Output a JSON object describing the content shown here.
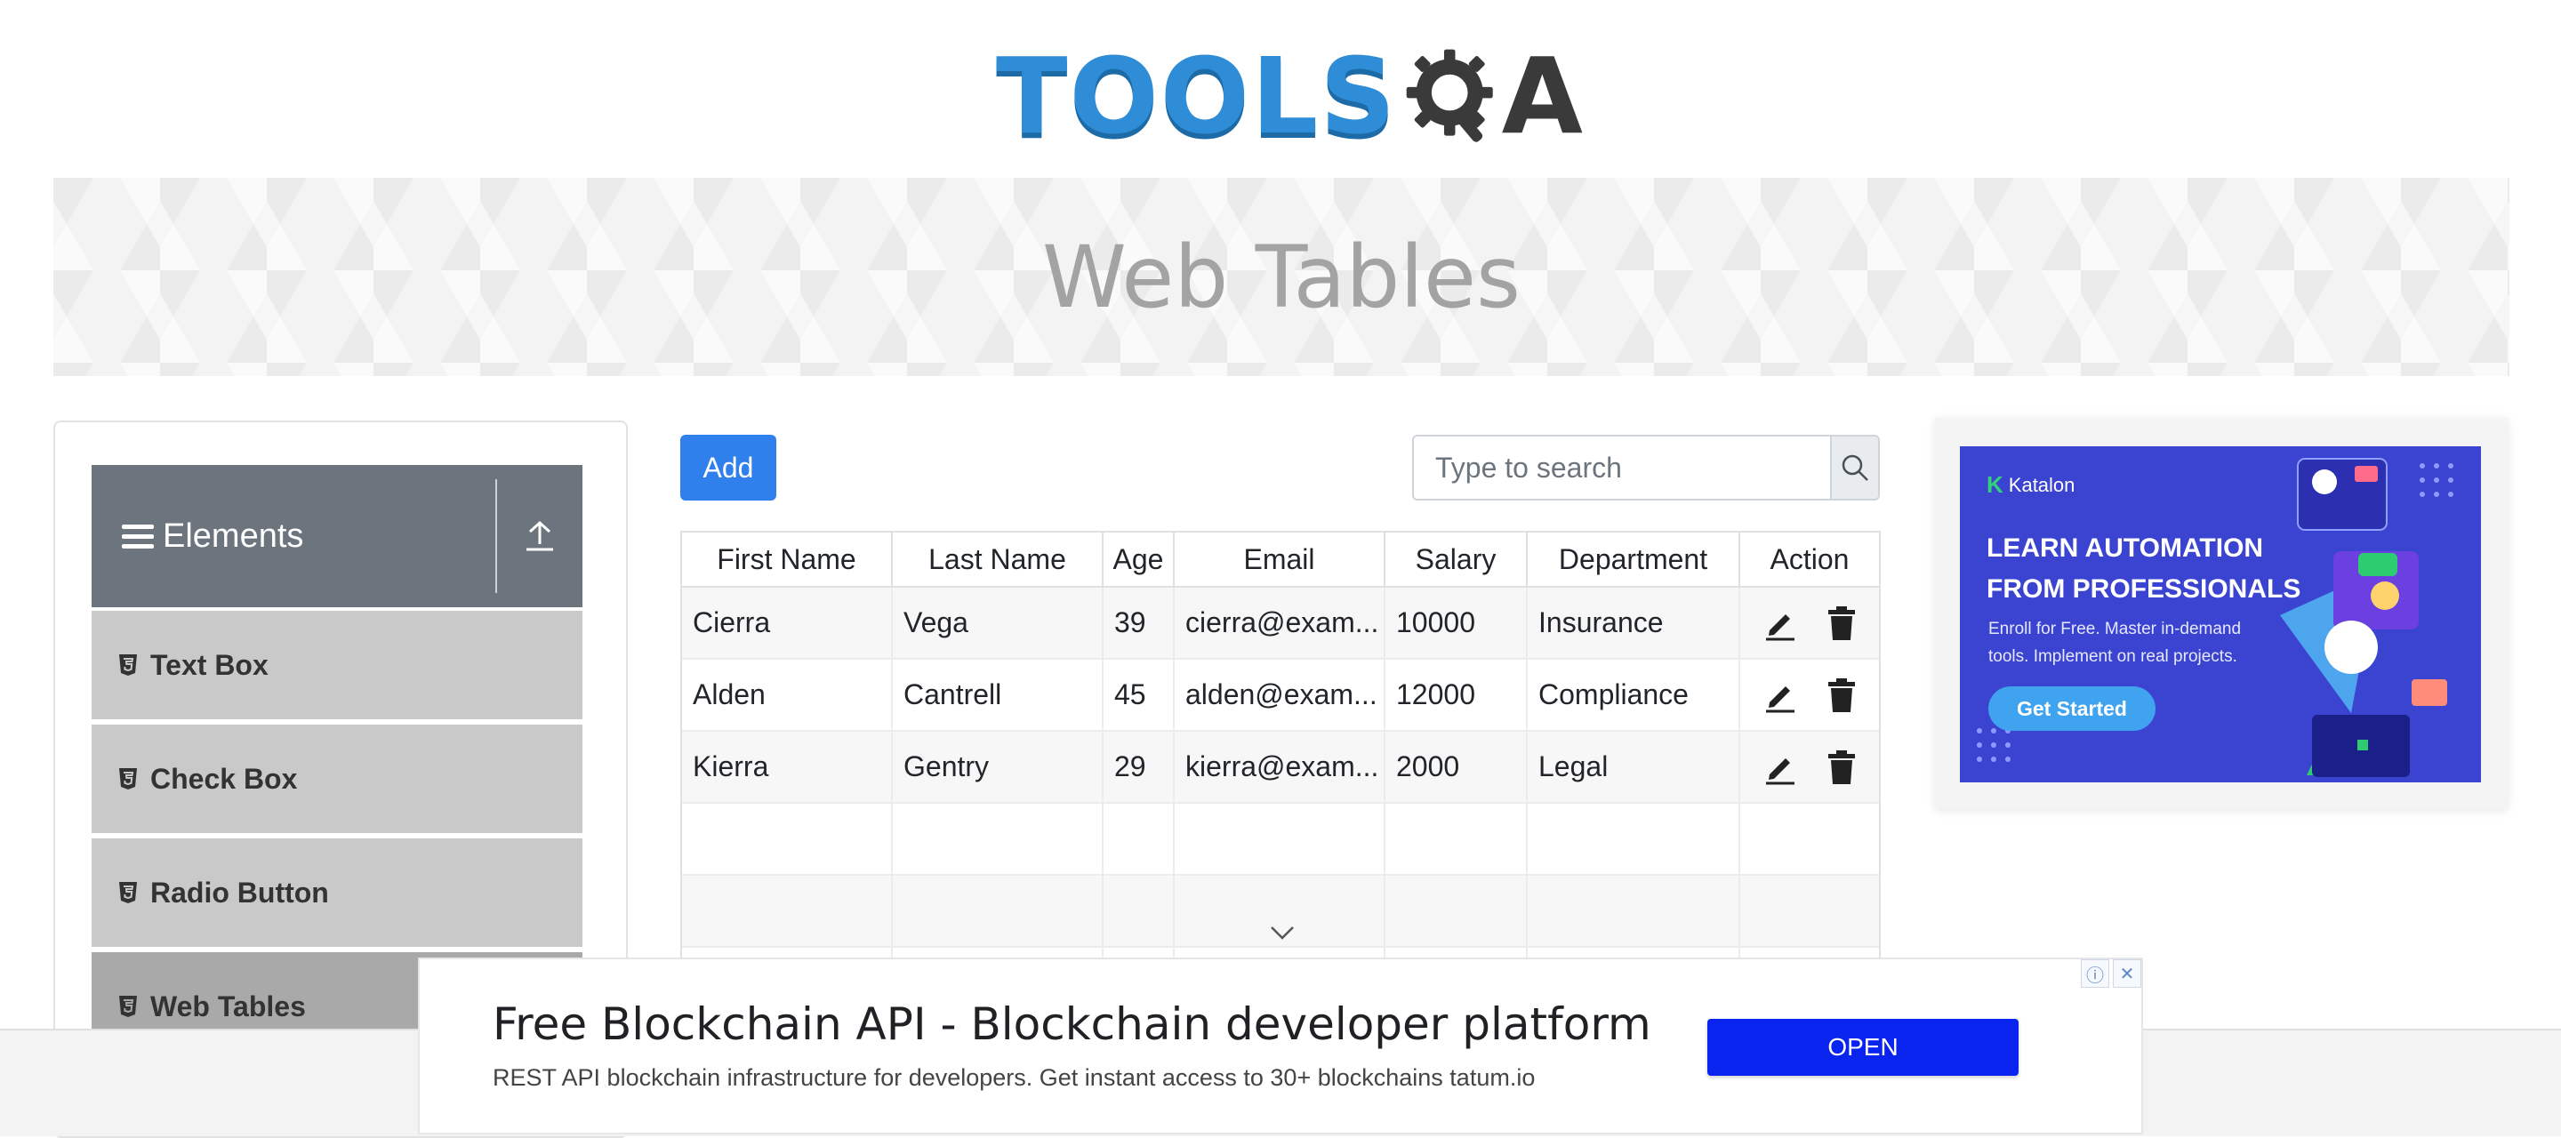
{
  "header": {
    "logo_text": "TOOLS",
    "logo_suffix": "A",
    "page_title": "Web Tables"
  },
  "sidebar": {
    "group_title": "Elements",
    "items": [
      {
        "label": "Text Box"
      },
      {
        "label": "Check Box"
      },
      {
        "label": "Radio Button"
      },
      {
        "label": "Web Tables"
      }
    ]
  },
  "toolbar": {
    "add_label": "Add",
    "search_placeholder": "Type to search"
  },
  "table": {
    "columns": [
      "First Name",
      "Last Name",
      "Age",
      "Email",
      "Salary",
      "Department",
      "Action"
    ],
    "rows": [
      [
        "Cierra",
        "Vega",
        "39",
        "cierra@exam...",
        "10000",
        "Insurance"
      ],
      [
        "Alden",
        "Cantrell",
        "45",
        "alden@exam...",
        "12000",
        "Compliance"
      ],
      [
        "Kierra",
        "Gentry",
        "29",
        "kierra@exam...",
        "2000",
        "Legal"
      ]
    ]
  },
  "right_ad": {
    "brand": "Katalon",
    "headline_line1": "LEARN AUTOMATION",
    "headline_line2": "FROM PROFESSIONALS",
    "subtext_line1": "Enroll for Free. Master in-demand",
    "subtext_line2": "tools. Implement on real projects.",
    "cta": "Get Started",
    "bg_color": "#3b44d0"
  },
  "bottom_ad": {
    "title": "Free Blockchain API - Blockchain developer platform",
    "description": "REST API blockchain infrastructure for developers. Get instant access to 30+ blockchains tatum.io",
    "open_label": "OPEN",
    "button_color": "#0a24f0"
  },
  "icons": {
    "menu": "hamburger-icon",
    "collapse": "upload-icon",
    "item": "html5-icon",
    "search": "search-icon",
    "edit": "pencil-icon",
    "delete": "trash-icon"
  },
  "colors": {
    "accent": "#2f80ed",
    "group_header": "#6c757d",
    "menu_item": "#c9c9c9",
    "logo_blue": "#2e8dd6"
  }
}
